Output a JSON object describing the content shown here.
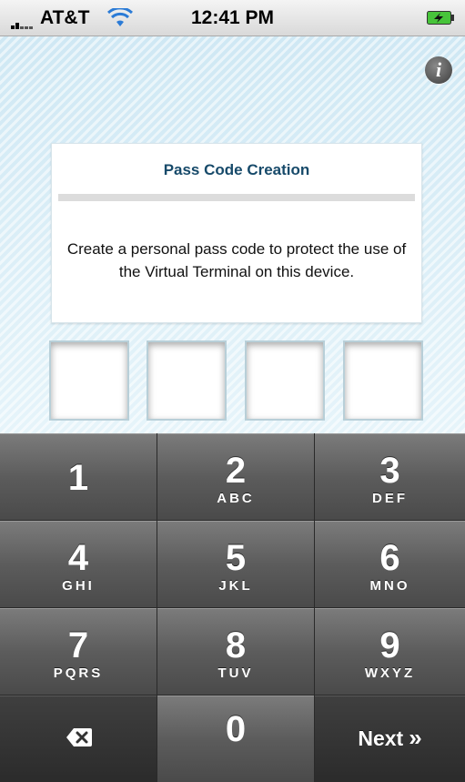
{
  "status_bar": {
    "carrier": "AT&T",
    "time": "12:41 PM"
  },
  "pass_code": {
    "title": "Pass Code Creation",
    "message": "Create a personal pass code to protect the use of the Virtual Terminal on this device.",
    "digit_count": 4
  },
  "info_button": {
    "icon": "info-icon",
    "label": "i"
  },
  "keypad": {
    "keys": [
      {
        "number": "1",
        "letters": ""
      },
      {
        "number": "2",
        "letters": "ABC"
      },
      {
        "number": "3",
        "letters": "DEF"
      },
      {
        "number": "4",
        "letters": "GHI"
      },
      {
        "number": "5",
        "letters": "JKL"
      },
      {
        "number": "6",
        "letters": "MNO"
      },
      {
        "number": "7",
        "letters": "PQRS"
      },
      {
        "number": "8",
        "letters": "TUV"
      },
      {
        "number": "9",
        "letters": "WXYZ"
      },
      {
        "number": "0",
        "letters": ""
      }
    ],
    "delete_icon": "backspace-icon",
    "next_label": "Next",
    "next_icon": "double-chevron-right-icon"
  },
  "colors": {
    "title_blue": "#174a6a",
    "background_light_blue": "#d8eef8",
    "key_gray": "#5c5c5c"
  }
}
